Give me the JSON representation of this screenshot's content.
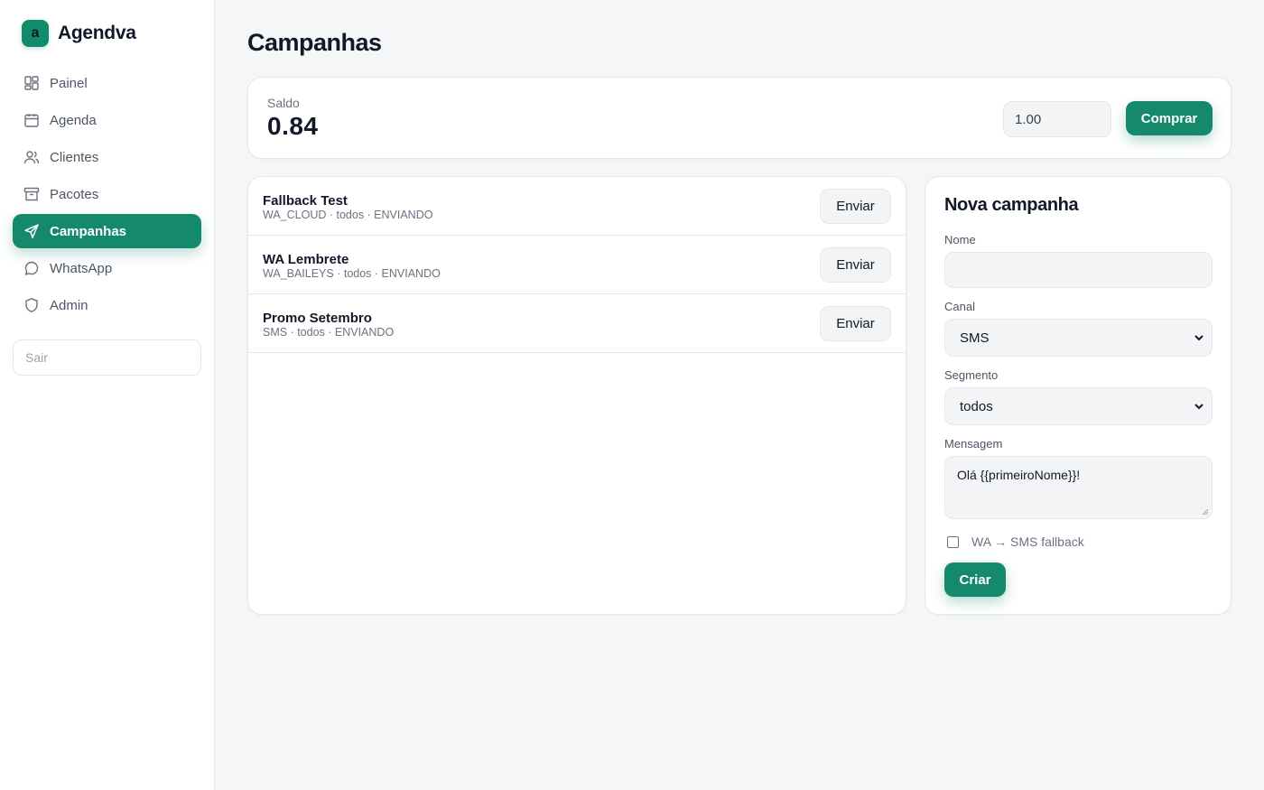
{
  "brand": {
    "logo_letter": "a",
    "name": "Agendva"
  },
  "colors": {
    "accent": "#14896c",
    "background": "#f5f6f7",
    "card": "#ffffff",
    "muted_text": "#6b7280"
  },
  "sidebar": {
    "items": [
      {
        "label": "Painel",
        "icon": "dashboard-icon",
        "active": false
      },
      {
        "label": "Agenda",
        "icon": "calendar-icon",
        "active": false
      },
      {
        "label": "Clientes",
        "icon": "users-icon",
        "active": false
      },
      {
        "label": "Pacotes",
        "icon": "archive-box-icon",
        "active": false
      },
      {
        "label": "Campanhas",
        "icon": "send-icon",
        "active": true
      },
      {
        "label": "WhatsApp",
        "icon": "chat-bubble-icon",
        "active": false
      },
      {
        "label": "Admin",
        "icon": "shield-icon",
        "active": false
      }
    ],
    "logout_label": "Sair"
  },
  "page": {
    "title": "Campanhas"
  },
  "balance": {
    "label": "Saldo",
    "value": "0.84",
    "amount_input_value": "1.00",
    "buy_label": "Comprar"
  },
  "campaigns": [
    {
      "name": "Fallback Test",
      "meta": "WA_CLOUD · todos · ENVIANDO",
      "send_label": "Enviar"
    },
    {
      "name": "WA Lembrete",
      "meta": "WA_BAILEYS · todos · ENVIANDO",
      "send_label": "Enviar"
    },
    {
      "name": "Promo Setembro",
      "meta": "SMS · todos · ENVIANDO",
      "send_label": "Enviar"
    }
  ],
  "new_campaign": {
    "title": "Nova campanha",
    "name_label": "Nome",
    "name_value": "",
    "channel_label": "Canal",
    "channel_value": "SMS",
    "segment_label": "Segmento",
    "segment_value": "todos",
    "message_label": "Mensagem",
    "message_value": "Olá {{primeiroNome}}!",
    "fallback_label": "WA → SMS fallback",
    "fallback_checked": false,
    "create_label": "Criar"
  }
}
